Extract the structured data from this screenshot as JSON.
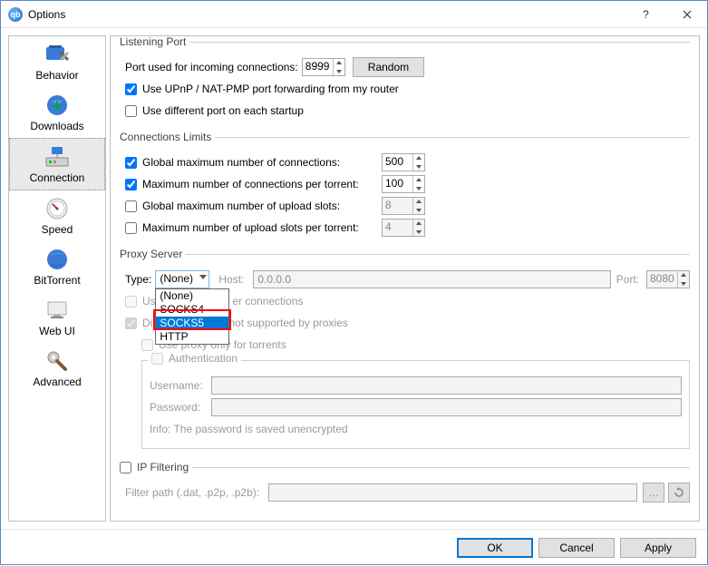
{
  "window": {
    "title": "Options"
  },
  "sidebar": {
    "items": [
      {
        "label": "Behavior"
      },
      {
        "label": "Downloads"
      },
      {
        "label": "Connection"
      },
      {
        "label": "Speed"
      },
      {
        "label": "BitTorrent"
      },
      {
        "label": "Web UI"
      },
      {
        "label": "Advanced"
      }
    ],
    "selected": 2
  },
  "listening_port": {
    "title": "Listening Port",
    "port_label": "Port used for incoming connections:",
    "port_value": "8999",
    "random_btn": "Random",
    "upnp_checked": true,
    "upnp_label": "Use UPnP / NAT-PMP port forwarding from my router",
    "diffport_checked": false,
    "diffport_label": "Use different port on each startup"
  },
  "conn_limits": {
    "title": "Connections Limits",
    "rows": [
      {
        "checked": true,
        "label": "Global maximum number of connections:",
        "value": "500",
        "enabled": true
      },
      {
        "checked": true,
        "label": "Maximum number of connections per torrent:",
        "value": "100",
        "enabled": true
      },
      {
        "checked": false,
        "label": "Global maximum number of upload slots:",
        "value": "8",
        "enabled": false
      },
      {
        "checked": false,
        "label": "Maximum number of upload slots per torrent:",
        "value": "4",
        "enabled": false
      }
    ]
  },
  "proxy": {
    "title": "Proxy Server",
    "type_label": "Type:",
    "type_value": "(None)",
    "type_options": [
      "(None)",
      "SOCKS4",
      "SOCKS5",
      "HTTP"
    ],
    "highlighted_option": "SOCKS5",
    "host_label": "Host:",
    "host_value": "0.0.0.0",
    "port_label": "Port:",
    "port_value": "8080",
    "peer_label_prefix": "Use",
    "peer_label_suffix": "er connections",
    "disable_label_prefix": "Dis",
    "disable_label_suffix": "not supported by proxies",
    "torrents_only_label": "Use proxy only for torrents",
    "auth": {
      "title": "Authentication",
      "username_label": "Username:",
      "password_label": "Password:",
      "info": "Info: The password is saved unencrypted"
    }
  },
  "ipfilter": {
    "title": "IP Filtering",
    "filter_path_label": "Filter path (.dat, .p2p, .p2b):"
  },
  "footer": {
    "ok": "OK",
    "cancel": "Cancel",
    "apply": "Apply"
  }
}
